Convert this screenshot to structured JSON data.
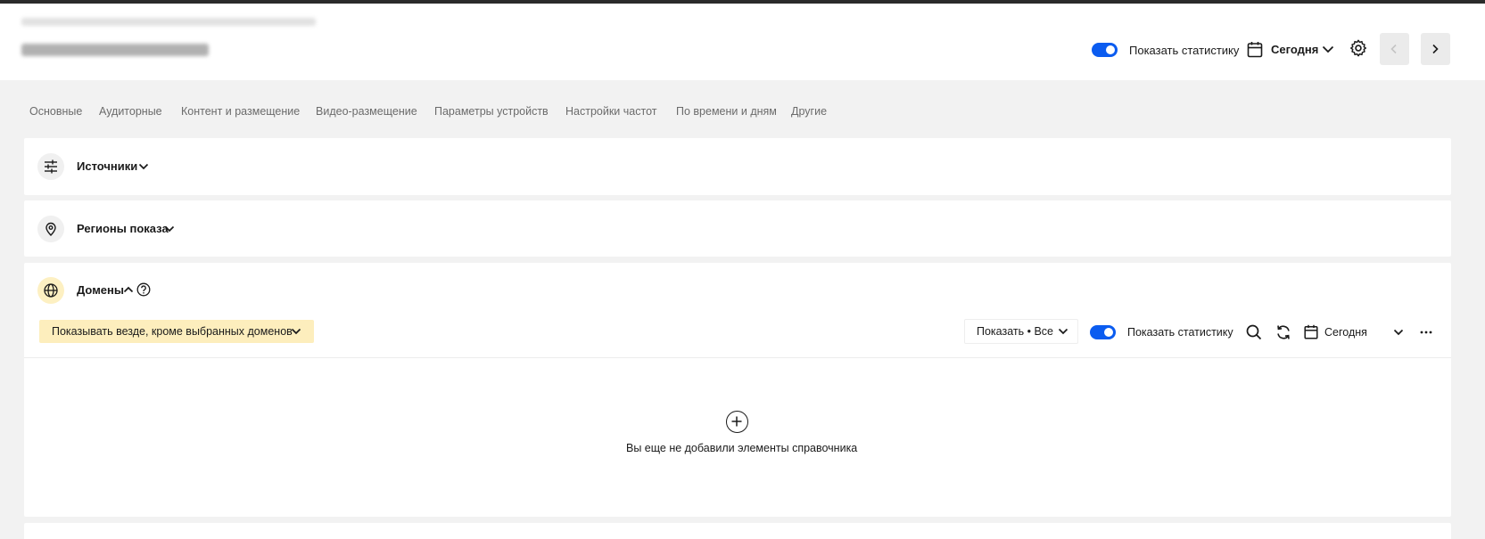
{
  "header": {
    "show_stats_label": "Показать статистику",
    "show_stats_on": true,
    "date_label": "Сегодня"
  },
  "tabs": [
    {
      "label": "Основные"
    },
    {
      "label": "Аудиторные"
    },
    {
      "label": "Контент и размещение"
    },
    {
      "label": "Видео-размещение"
    },
    {
      "label": "Параметры устройств"
    },
    {
      "label": "Настройки частот"
    },
    {
      "label": "По времени и дням"
    },
    {
      "label": "Другие"
    }
  ],
  "sections": {
    "sources": {
      "title": "Источники"
    },
    "regions": {
      "title": "Регионы показа"
    },
    "domains": {
      "title": "Домены",
      "mode_label": "Показывать везде, кроме выбранных доменов",
      "show_filter_label": "Показать • Все",
      "show_stats_label": "Показать статистику",
      "show_stats_on": true,
      "date_label": "Сегодня",
      "empty_text": "Вы еще не добавили элементы справочника"
    }
  },
  "colors": {
    "toggle_on": "#0b5cf0",
    "mode_highlight": "#fdeebd",
    "domain_icon_bg": "#fdf0c2",
    "page_bg": "#f2f2f2"
  },
  "icons": [
    "calendar-icon",
    "chevron-down-icon",
    "gear-icon",
    "chevron-left-icon",
    "chevron-right-icon",
    "sliders-icon",
    "map-pin-icon",
    "globe-icon",
    "chevron-up-icon",
    "help-icon",
    "search-icon",
    "refresh-icon",
    "more-icon",
    "plus-icon"
  ]
}
